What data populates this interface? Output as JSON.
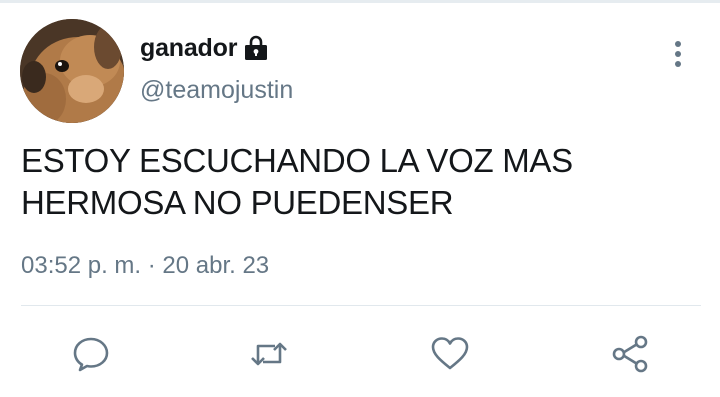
{
  "tweet": {
    "display_name": "ganador",
    "handle": "@teamojustin",
    "protected_icon": "lock-icon",
    "avatar": "dog-avatar",
    "text_lines": [
      "ESTOY ESCUCHANDO LA VOZ MAS",
      "HERMOSA NO PUEDENSER"
    ],
    "timestamp": "03:52 p. m. · 20 abr. 23"
  },
  "actions": [
    {
      "name": "reply",
      "icon": "speech-bubble-icon"
    },
    {
      "name": "retweet",
      "icon": "retweet-icon"
    },
    {
      "name": "like",
      "icon": "heart-icon"
    },
    {
      "name": "share",
      "icon": "share-icon"
    }
  ],
  "colors": {
    "text": "#14171a",
    "secondary": "#657786",
    "icon": "#657786",
    "divider": "#e1e8ed"
  }
}
